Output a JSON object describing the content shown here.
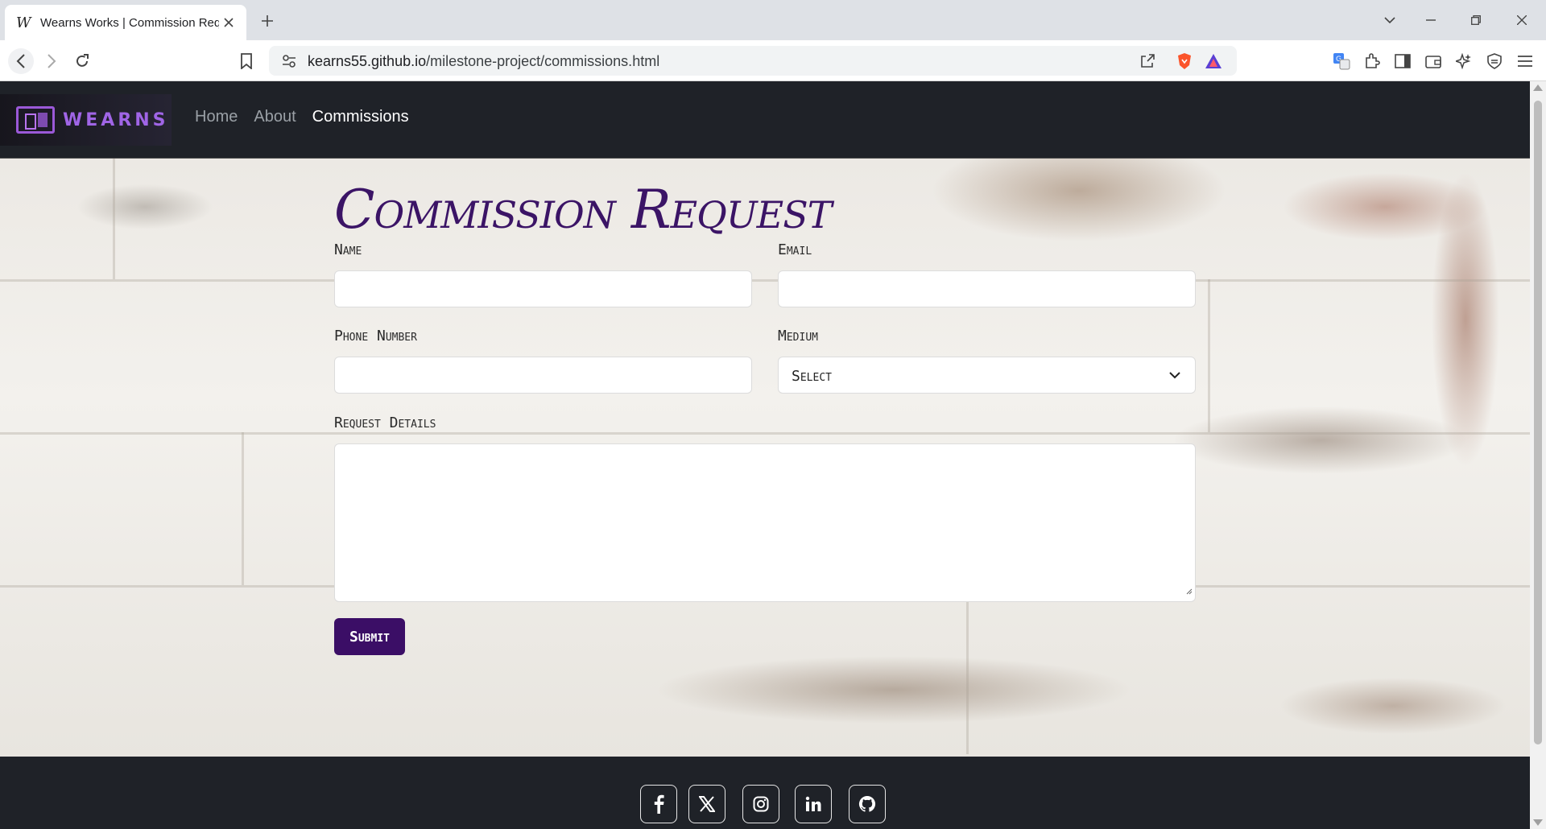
{
  "browser": {
    "tab": {
      "title": "Wearns Works | Commission Request",
      "favicon": "w-italic-icon"
    },
    "url": {
      "host": "kearns55.github.io",
      "path": "/milestone-project/commissions.html"
    }
  },
  "nav": {
    "brand_text": "WEARNS",
    "links": [
      {
        "label": "Home",
        "active": false
      },
      {
        "label": "About",
        "active": false
      },
      {
        "label": "Commissions",
        "active": true
      }
    ]
  },
  "form": {
    "title": "Commission Request",
    "fields": {
      "name": {
        "label": "Name",
        "value": ""
      },
      "email": {
        "label": "Email",
        "value": ""
      },
      "phone": {
        "label": "Phone Number",
        "value": ""
      },
      "medium": {
        "label": "Medium",
        "selected": "Select"
      },
      "details": {
        "label": "Request Details",
        "value": ""
      }
    },
    "submit_label": "Submit"
  },
  "footer": {
    "social": [
      "facebook-icon",
      "x-twitter-icon",
      "instagram-icon",
      "linkedin-icon",
      "github-icon"
    ]
  },
  "colors": {
    "navbar": "#1f2228",
    "title": "#3b1466",
    "submit_bg": "#3b0e66",
    "brand": "#a065e6"
  }
}
